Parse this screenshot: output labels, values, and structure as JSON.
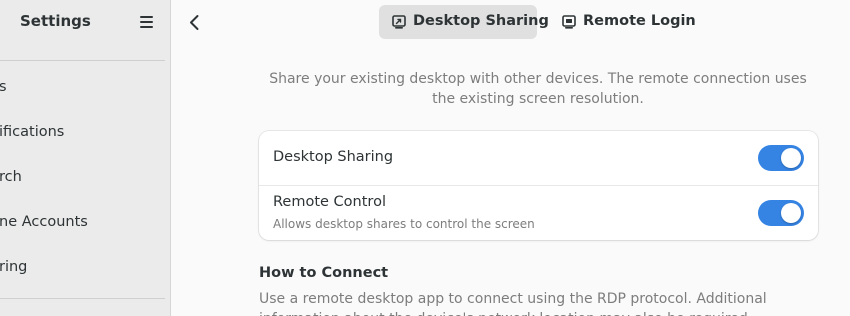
{
  "sidebar": {
    "title": "Settings",
    "menu_icon": "hamburger-menu-icon",
    "items": [
      {
        "label": "s"
      },
      {
        "label": "ifications"
      },
      {
        "label": "rch"
      },
      {
        "label": "ne Accounts"
      },
      {
        "label": "ring"
      }
    ]
  },
  "header": {
    "back_icon": "back-arrow-icon",
    "tabs": [
      {
        "label": "Desktop Sharing",
        "icon": "desktop-sharing-icon",
        "active": true
      },
      {
        "label": "Remote Login",
        "icon": "remote-login-icon",
        "active": false
      }
    ]
  },
  "main": {
    "description": "Share your existing desktop with other devices. The remote connection uses the existing screen resolution.",
    "settings": [
      {
        "title": "Desktop Sharing",
        "subtitle": "",
        "enabled": true
      },
      {
        "title": "Remote Control",
        "subtitle": "Allows desktop shares to control the screen",
        "enabled": true
      }
    ],
    "how_to_connect": {
      "heading": "How to Connect",
      "body": "Use a remote desktop app to connect using the RDP protocol. Additional information about the device's network location may also be required."
    }
  },
  "colors": {
    "accent": "#3584e4",
    "sidebar_bg": "#ebebeb",
    "content_bg": "#fafafa",
    "active_tab_bg": "#e0e0e0"
  }
}
